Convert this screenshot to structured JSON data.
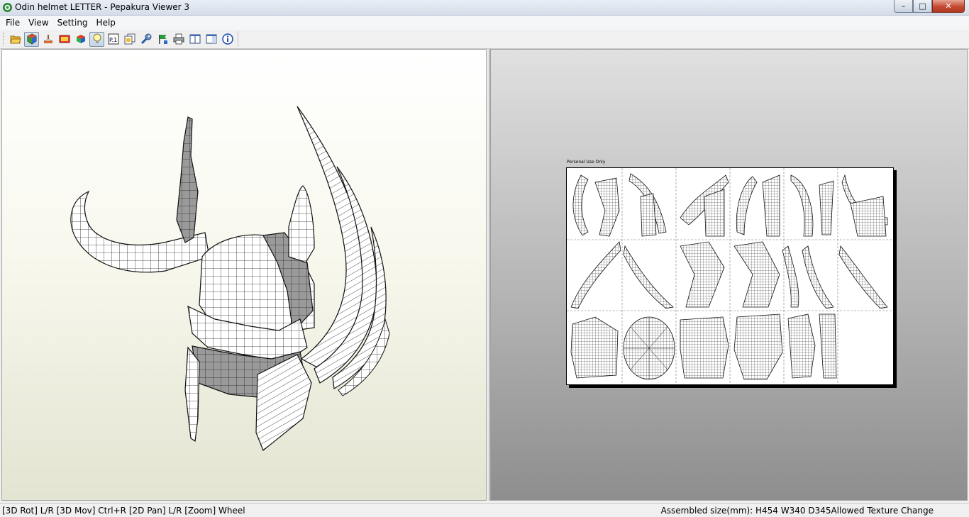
{
  "window": {
    "title": "Odin helmet LETTER - Pepakura Viewer 3",
    "controls": {
      "minimize": "–",
      "maximize": "□",
      "close": "✕"
    }
  },
  "menu": [
    "File",
    "View",
    "Setting",
    "Help"
  ],
  "toolbar": {
    "buttons": [
      {
        "icon": "open-folder-icon",
        "pressed": false
      },
      {
        "icon": "3d-model-icon",
        "pressed": true
      },
      {
        "icon": "paint-brush-icon",
        "pressed": false
      },
      {
        "icon": "texture-icon",
        "pressed": false
      },
      {
        "icon": "cube-colors-icon",
        "pressed": false
      },
      {
        "icon": "light-bulb-icon",
        "pressed": true
      },
      {
        "icon": "page-number-icon",
        "pressed": false
      },
      {
        "icon": "pages-icon",
        "pressed": false
      },
      {
        "icon": "wrench-icon",
        "pressed": false
      },
      {
        "icon": "flag-icon",
        "pressed": false
      },
      {
        "icon": "print-icon",
        "pressed": false
      },
      {
        "icon": "left-pane-icon",
        "pressed": false
      },
      {
        "icon": "right-pane-icon",
        "pressed": false
      },
      {
        "icon": "info-icon",
        "pressed": false
      }
    ],
    "page_number_text": "P.1"
  },
  "sheet": {
    "label": "Personal Use Only"
  },
  "status": {
    "left": "[3D Rot] L/R [3D Mov] Ctrl+R [2D Pan] L/R [Zoom] Wheel",
    "right": "Assembled size(mm): H454 W340 D345Allowed Texture Change"
  },
  "colors": {
    "accent": "#3c7fb1",
    "close": "#c44a32",
    "background_2d": "#b4b4b4",
    "background_3d": "#f8f8ee"
  }
}
